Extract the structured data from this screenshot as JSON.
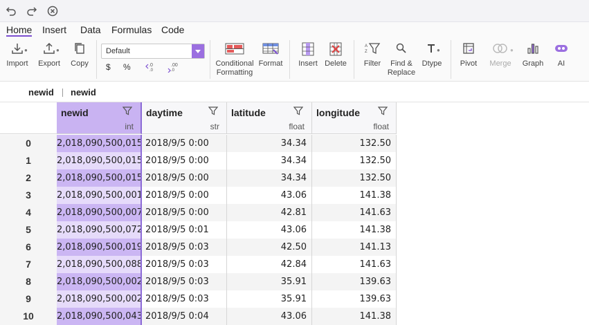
{
  "menu": {
    "items": [
      "Home",
      "Insert",
      "Data",
      "Formulas",
      "Code"
    ],
    "active": "Home"
  },
  "ribbon": {
    "import": "Import",
    "export": "Export",
    "copy": "Copy",
    "format_select": "Default",
    "currency": "$",
    "percent": "%",
    "cond_format_line1": "Conditional",
    "cond_format_line2": "Formatting",
    "format": "Format",
    "insert": "Insert",
    "delete": "Delete",
    "filter": "Filter",
    "find_line1": "Find &",
    "find_line2": "Replace",
    "dtype": "Dtype",
    "pivot": "Pivot",
    "merge": "Merge",
    "graph": "Graph",
    "ai": "AI"
  },
  "breadcrumb": {
    "first": "newid",
    "second": "newid"
  },
  "colors": {
    "accent": "#9b6fe0",
    "selected_header": "#c9b3f2",
    "selected_col_odd": "#cbb6f3",
    "selected_col_even": "#e6dbfa"
  },
  "table": {
    "columns": [
      {
        "name": "newid",
        "dtype": "int"
      },
      {
        "name": "daytime",
        "dtype": "str"
      },
      {
        "name": "latitude",
        "dtype": "float"
      },
      {
        "name": "longitude",
        "dtype": "float"
      }
    ],
    "rows": [
      {
        "index": "0",
        "cells": [
          "2,018,090,500,015",
          "2018/9/5 0:00",
          "34.34",
          "132.50"
        ]
      },
      {
        "index": "1",
        "cells": [
          "2,018,090,500,015",
          "2018/9/5 0:00",
          "34.34",
          "132.50"
        ]
      },
      {
        "index": "2",
        "cells": [
          "2,018,090,500,015",
          "2018/9/5 0:00",
          "34.34",
          "132.50"
        ]
      },
      {
        "index": "3",
        "cells": [
          "2,018,090,500,001",
          "2018/9/5 0:00",
          "43.06",
          "141.38"
        ]
      },
      {
        "index": "4",
        "cells": [
          "2,018,090,500,007",
          "2018/9/5 0:00",
          "42.81",
          "141.63"
        ]
      },
      {
        "index": "5",
        "cells": [
          "2,018,090,500,072",
          "2018/9/5 0:01",
          "43.06",
          "141.38"
        ]
      },
      {
        "index": "6",
        "cells": [
          "2,018,090,500,019",
          "2018/9/5 0:03",
          "42.50",
          "141.13"
        ]
      },
      {
        "index": "7",
        "cells": [
          "2,018,090,500,088",
          "2018/9/5 0:03",
          "42.84",
          "141.63"
        ]
      },
      {
        "index": "8",
        "cells": [
          "2,018,090,500,002",
          "2018/9/5 0:03",
          "35.91",
          "139.63"
        ]
      },
      {
        "index": "9",
        "cells": [
          "2,018,090,500,002",
          "2018/9/5 0:03",
          "35.91",
          "139.63"
        ]
      },
      {
        "index": "10",
        "cells": [
          "2,018,090,500,043",
          "2018/9/5 0:04",
          "43.06",
          "141.38"
        ]
      }
    ]
  }
}
